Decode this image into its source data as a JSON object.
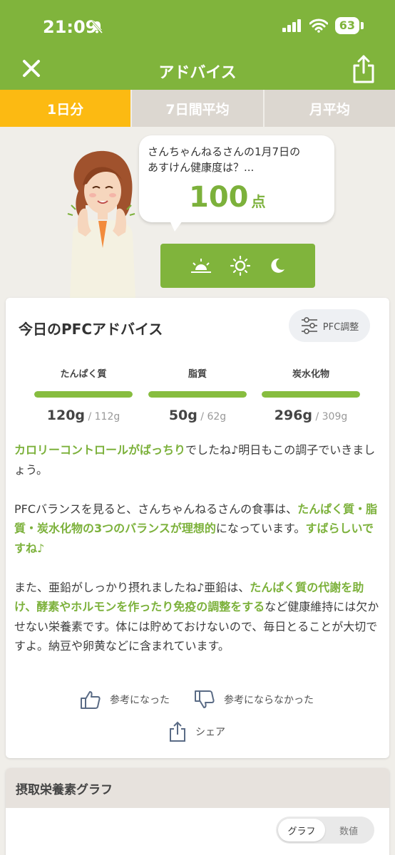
{
  "status_bar": {
    "time": "21:09",
    "battery": "63"
  },
  "nav": {
    "title": "アドバイス"
  },
  "tabs": [
    {
      "label": "1日分",
      "active": true
    },
    {
      "label": "7日間平均",
      "active": false
    },
    {
      "label": "月平均",
      "active": false
    }
  ],
  "bubble": {
    "line1": "さんちゃんねるさんの1月7日の",
    "line2": "あすけん健康度は？...",
    "score": "100",
    "unit": "点"
  },
  "time_of_day": [
    "sunrise-icon",
    "sun-icon",
    "moon-icon"
  ],
  "pfc_card": {
    "title": "今日のPFCアドバイス",
    "adjust_button": "PFC調整",
    "metrics": [
      {
        "label": "たんぱく質",
        "actual": "120g",
        "target": " / 112g",
        "fill_fraction": 1.0
      },
      {
        "label": "脂質",
        "actual": "50g",
        "target": " / 62g",
        "fill_fraction": 1.0
      },
      {
        "label": "炭水化物",
        "actual": "296g",
        "target": " / 309g",
        "fill_fraction": 1.0
      }
    ],
    "advice": {
      "p1_hl": "カロリーコントロールがばっちり",
      "p1_rest": "でしたね♪明日もこの調子でいきましょう。",
      "p2_a": "PFCバランスを見ると、さんちゃんねるさんの食事は、",
      "p2_hl": "たんぱく質・脂質・炭水化物の3つのバランスが理想的",
      "p2_b": "になっています。",
      "p2_hl2": "すばらしいですね♪",
      "p3_a": "また、亜鉛がしっかり摂れましたね♪亜鉛は、",
      "p3_hl": "たんぱく質の代謝を助け、酵素やホルモンを作ったり免疫の調整をする",
      "p3_b": "など健康維持には欠かせない栄養素です。体には貯めておけないので、毎日とることが大切ですよ。納豆や卵黄などに含まれています。"
    },
    "feedback": {
      "helpful": "参考になった",
      "not_helpful": "参考にならなかった",
      "share": "シェア"
    }
  },
  "graph_card": {
    "title": "摂取栄養素グラフ",
    "toggle": [
      "グラフ",
      "数値"
    ]
  },
  "colors": {
    "brand_green": "#80b43c",
    "tab_active": "#fcba12",
    "highlight": "#7cb13b"
  }
}
